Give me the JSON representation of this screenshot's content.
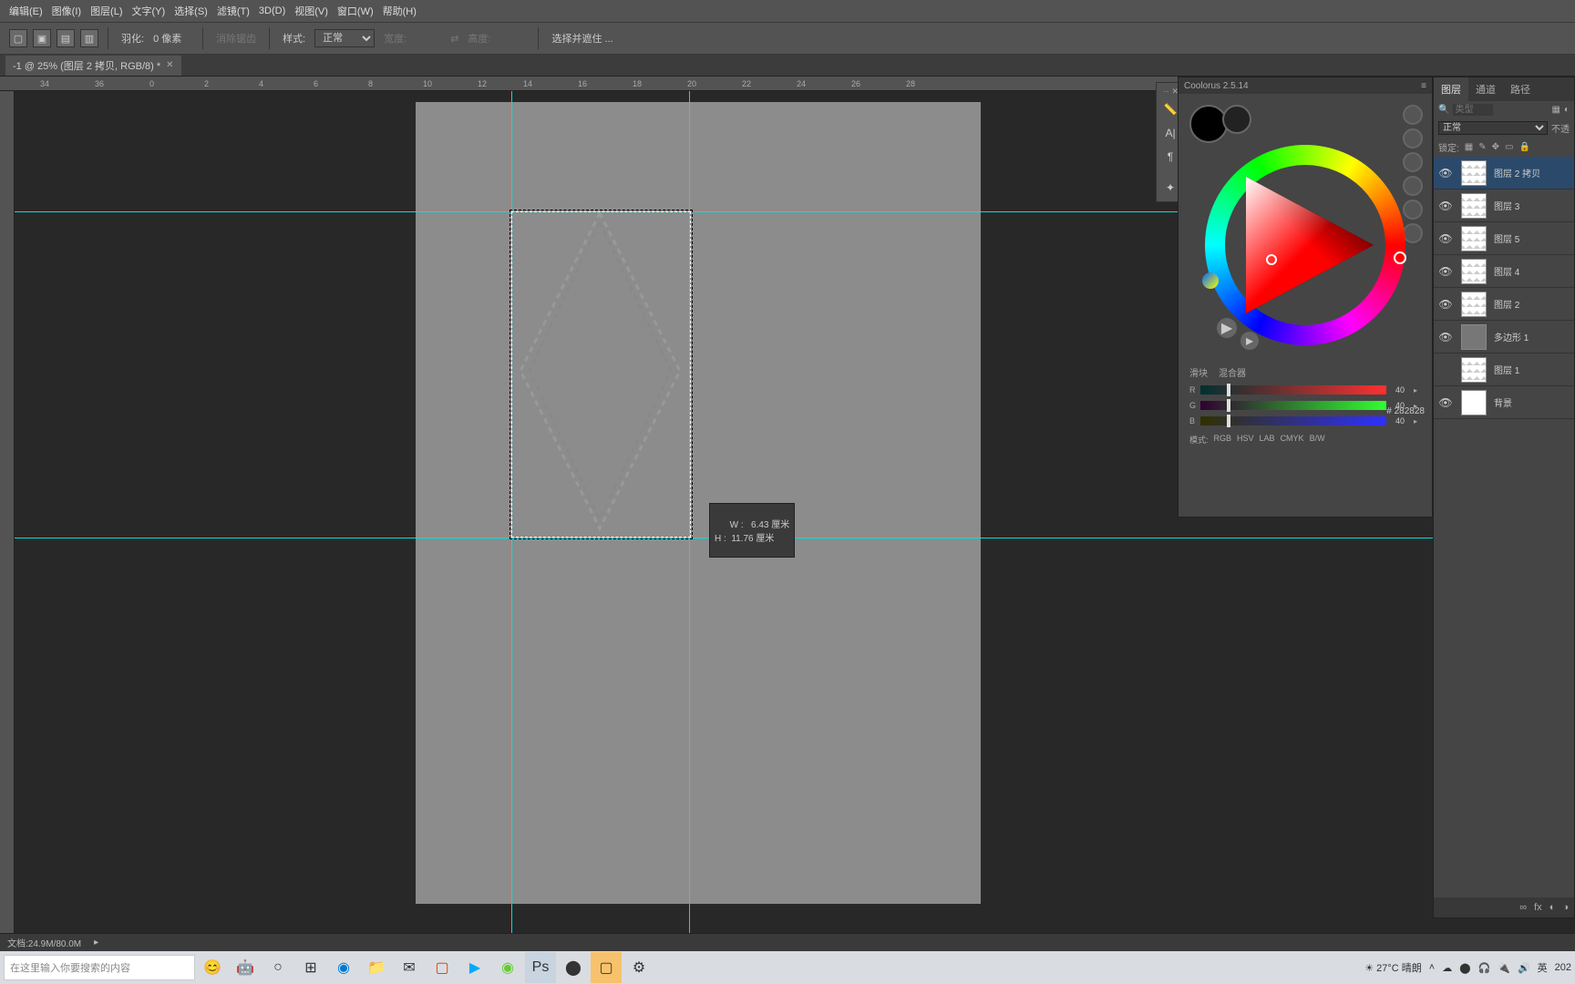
{
  "menu": {
    "items": [
      "编辑(E)",
      "图像(I)",
      "图层(L)",
      "文字(Y)",
      "选择(S)",
      "滤镜(T)",
      "3D(D)",
      "视图(V)",
      "窗口(W)",
      "帮助(H)"
    ]
  },
  "options": {
    "feather_label": "羽化:",
    "feather_value": "0 像素",
    "antialias": "消除锯齿",
    "style_label": "样式:",
    "style_value": "正常",
    "width_label": "宽度:",
    "height_label": "高度:",
    "refine": "选择并遮住 ..."
  },
  "tab": {
    "title": "-1 @ 25% (图层 2 拷贝, RGB/8) *"
  },
  "ruler_ticks": [
    "34",
    "36",
    "0",
    "2",
    "4",
    "6",
    "8",
    "10",
    "12",
    "14",
    "16",
    "18",
    "20",
    "22",
    "24",
    "26",
    "28"
  ],
  "tooltip": {
    "row1": "W :   6.43 厘米",
    "row2": "H :  11.76 厘米"
  },
  "coolorus": {
    "title": "Coolorus 2.5.14",
    "hex": "# 282828",
    "tab1": "滑块",
    "tab2": "混合器",
    "sliders": [
      {
        "l": "R",
        "v": "40"
      },
      {
        "l": "G",
        "v": "40"
      },
      {
        "l": "B",
        "v": "40"
      }
    ],
    "modes": [
      "模式:",
      "RGB",
      "HSV",
      "LAB",
      "CMYK",
      "B/W"
    ]
  },
  "layers_panel": {
    "tabs": [
      "图层",
      "通道",
      "路径"
    ],
    "filter_placeholder": "类型",
    "blend": "正常",
    "opacity_label": "不透",
    "lock": "锁定:",
    "items": [
      {
        "name": "图层 2 拷贝",
        "visible": true
      },
      {
        "name": "图层 3",
        "visible": true
      },
      {
        "name": "图层 5",
        "visible": true
      },
      {
        "name": "图层 4",
        "visible": true
      },
      {
        "name": "图层 2",
        "visible": true
      },
      {
        "name": "多边形 1",
        "visible": true
      },
      {
        "name": "图层 1",
        "visible": false
      },
      {
        "name": "背景",
        "visible": true,
        "bg": true
      }
    ]
  },
  "status": {
    "zoom": "",
    "doc": "文档:24.9M/80.0M"
  },
  "taskbar": {
    "search_placeholder": "在这里输入你要搜索的内容",
    "weather": "27°C 晴朗",
    "time": "202"
  }
}
